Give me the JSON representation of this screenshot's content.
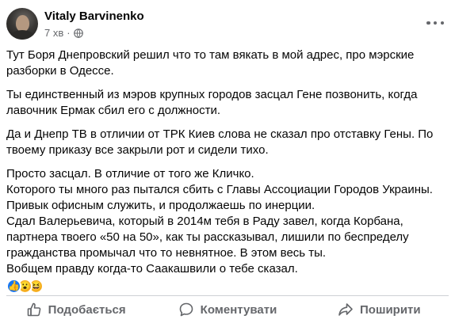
{
  "post": {
    "author": "Vitaly Barvinenko",
    "time": "7 хв",
    "separator": "·",
    "paragraphs": [
      "Тут Боря Днепровский решил что то там вякать в мой адрес, про мэрские разборки в Одессе.",
      " Ты единственный из мэров крупных городов засцал Гене позвонить, когда лавочник Ермак сбил его с должности.",
      "Да и Днепр ТВ в отличии от ТРК Киев слова не сказал про отставку Гены. По твоему приказу все закрыли рот и сидели тихо."
    ],
    "closing_lines": [
      "Просто засцал. В отличие от того же Кличко.",
      "Которого ты много раз пытался сбить с Главы Ассоциации Городов Украины.",
      "Привык офисным служить, и продолжаешь по инерции.",
      "Сдал Валерьевича, который в 2014м тебя в Раду завел, когда Корбана, партнера твоего «50 на 50», как ты рассказывал, лишили по беспределу гражданства промычал что то невнятное. В этом весь ты.",
      "Вобщем правду когда-то Саакашвили о тебе сказал."
    ]
  },
  "reactions": {
    "icons": [
      "like-reaction",
      "wow-reaction",
      "haha-reaction"
    ],
    "like_glyph": "👍",
    "wow_glyph": "😮",
    "haha_glyph": "😆"
  },
  "actions": {
    "like_label": "Подобається",
    "comment_label": "Коментувати",
    "share_label": "Поширити"
  },
  "colors": {
    "accent": "#1877f2",
    "secondary_text": "#65676b"
  }
}
